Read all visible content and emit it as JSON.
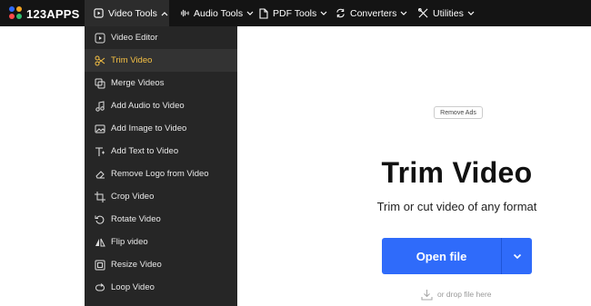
{
  "brand": {
    "name": "123APPS"
  },
  "nav": [
    {
      "label": "Video Tools",
      "icon": "video-play-icon"
    },
    {
      "label": "Audio Tools",
      "icon": "audio-wave-icon"
    },
    {
      "label": "PDF Tools",
      "icon": "pdf-document-icon"
    },
    {
      "label": "Converters",
      "icon": "convert-arrows-icon"
    },
    {
      "label": "Utilities",
      "icon": "tools-icon"
    }
  ],
  "menu": [
    {
      "label": "Video Editor",
      "icon": "video-editor-icon"
    },
    {
      "label": "Trim Video",
      "icon": "scissors-icon"
    },
    {
      "label": "Merge Videos",
      "icon": "merge-icon"
    },
    {
      "label": "Add Audio to Video",
      "icon": "music-note-icon"
    },
    {
      "label": "Add Image to Video",
      "icon": "image-icon"
    },
    {
      "label": "Add Text to Video",
      "icon": "text-icon"
    },
    {
      "label": "Remove Logo from Video",
      "icon": "eraser-icon"
    },
    {
      "label": "Crop Video",
      "icon": "crop-icon"
    },
    {
      "label": "Rotate Video",
      "icon": "rotate-icon"
    },
    {
      "label": "Flip video",
      "icon": "flip-icon"
    },
    {
      "label": "Resize Video",
      "icon": "resize-icon"
    },
    {
      "label": "Loop Video",
      "icon": "loop-icon"
    }
  ],
  "active_menu_item": "Trim Video",
  "main": {
    "remove_ads": "Remove Ads",
    "title": "Trim Video",
    "subtitle": "Trim or cut video of any format",
    "open_file": "Open file",
    "drop_hint": "or drop file here"
  },
  "colors": {
    "topbar": "#141414",
    "menu_bg": "#262626",
    "accent": "#f5c044",
    "button": "#2f6bfa"
  }
}
